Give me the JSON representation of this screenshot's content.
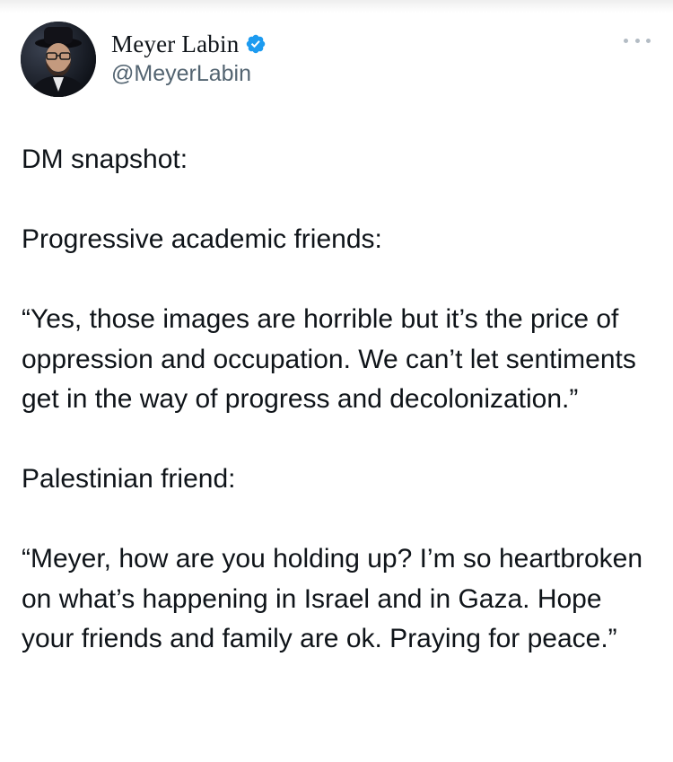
{
  "author": {
    "display_name": "Meyer Labin",
    "handle": "@MeyerLabin",
    "verified": true,
    "avatar_icon": "profile-photo",
    "verified_icon": "verified-badge-icon"
  },
  "colors": {
    "text": "#0f1419",
    "secondary_text": "#536471",
    "verified_blue": "#1d9bf0",
    "more_dots": "#b3bcc4"
  },
  "tweet": {
    "paragraphs": [
      "DM snapshot:",
      "Progressive academic friends:",
      "“Yes, those images are horrible but it’s the price of oppression and occupation. We can’t let sentiments get in the way of progress and decolonization.”",
      "Palestinian friend:",
      "“Meyer, how are you holding up? I’m so heartbroken on what’s happening in Israel and in Gaza. Hope your friends and family are ok. Praying for peace.”"
    ]
  }
}
